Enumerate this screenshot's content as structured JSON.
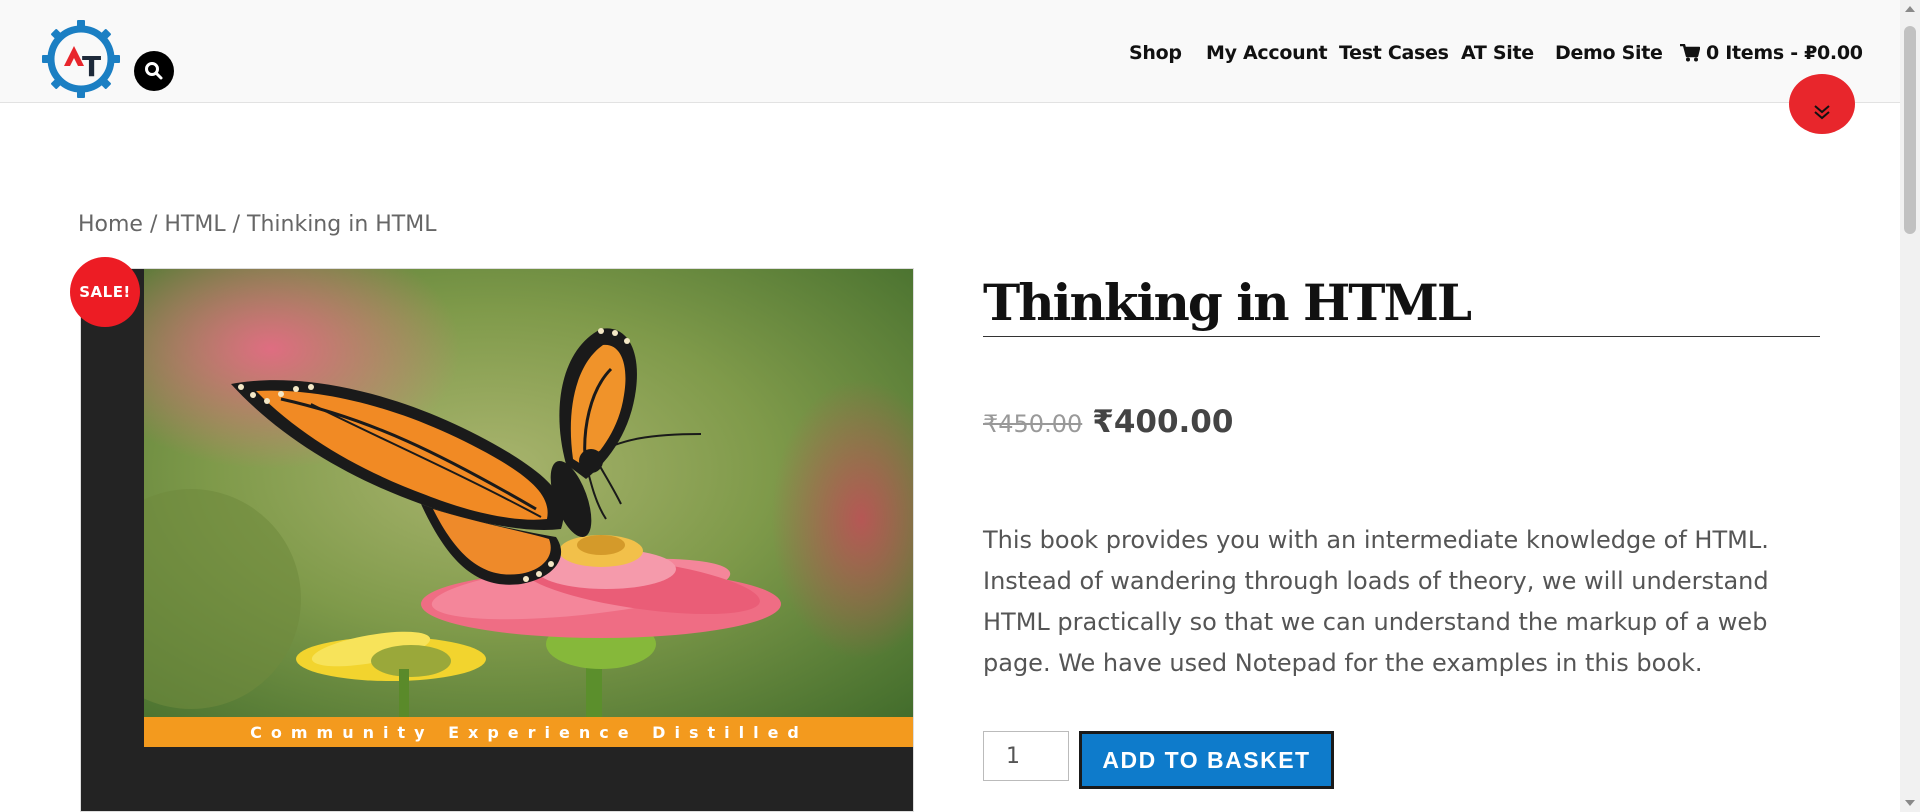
{
  "header": {
    "logo_text": "T",
    "nav": [
      {
        "label": "Shop"
      },
      {
        "label": "My Account"
      },
      {
        "label": "Test Cases"
      },
      {
        "label": "AT Site"
      },
      {
        "label": "Demo Site"
      }
    ],
    "cart_label": "0 Items - ₽0.00"
  },
  "breadcrumb": {
    "home": "Home",
    "sep1": " / ",
    "category": "HTML",
    "sep2": " / ",
    "current": "Thinking in HTML"
  },
  "product": {
    "sale_badge": "SALE!",
    "cover_band_text": "Community Experience Distilled",
    "title": "Thinking in HTML",
    "old_price": "₹450.00",
    "new_price": "₹400.00",
    "description": "This book provides you with an intermediate knowledge of HTML. Instead of wandering through loads of theory, we will understand HTML practically so that we can understand the markup of a web page. We have used Notepad for the examples in this book.",
    "quantity": "1",
    "add_button": "ADD TO BASKET"
  },
  "colors": {
    "accent": "#0e7bcb",
    "sale": "#ed1c24",
    "logo_blue": "#1b7fc3"
  },
  "icons": {
    "search": "search-icon",
    "cart": "cart-icon",
    "collapse": "chevron-double-down-icon"
  }
}
